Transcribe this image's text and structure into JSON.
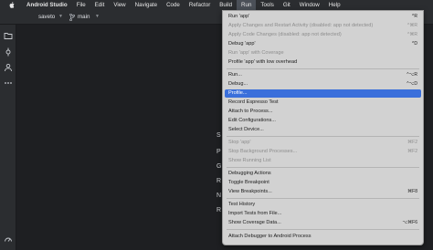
{
  "menubar": {
    "items": [
      {
        "label": "Android Studio"
      },
      {
        "label": "File"
      },
      {
        "label": "Edit"
      },
      {
        "label": "View"
      },
      {
        "label": "Navigate"
      },
      {
        "label": "Code"
      },
      {
        "label": "Refactor"
      },
      {
        "label": "Build"
      },
      {
        "label": "Run"
      },
      {
        "label": "Tools"
      },
      {
        "label": "Git"
      },
      {
        "label": "Window"
      },
      {
        "label": "Help"
      }
    ]
  },
  "toolbar": {
    "project": "saveto",
    "branch": "main"
  },
  "left_toolbar": {
    "icons": [
      "folder-icon",
      "commit-icon",
      "people-icon",
      "more-icon",
      "performance-icon"
    ]
  },
  "editor": {
    "edge_letters": [
      "S",
      "P",
      "G",
      "R",
      "N",
      "R"
    ]
  },
  "run_menu": {
    "items": [
      {
        "label": "Run 'app'",
        "shortcut": "^R",
        "disabled": false
      },
      {
        "label": "Apply Changes and Restart Activity (disabled: app not detected)",
        "shortcut": "^⌘R",
        "disabled": true
      },
      {
        "label": "Apply Code Changes (disabled: app not detected)",
        "shortcut": "^⌘R",
        "disabled": true
      },
      {
        "label": "Debug 'app'",
        "shortcut": "^D",
        "disabled": false
      },
      {
        "label": "Run 'app' with Coverage",
        "shortcut": "",
        "disabled": true
      },
      {
        "label": "Profile 'app' with low overhead",
        "shortcut": "",
        "disabled": false
      },
      {
        "label": "Run...",
        "shortcut": "^⌥R",
        "disabled": false
      },
      {
        "label": "Debug...",
        "shortcut": "^⌥D",
        "disabled": false
      },
      {
        "label": "Profile...",
        "shortcut": "",
        "disabled": false,
        "selected": true
      },
      {
        "label": "Record Espresso Test",
        "shortcut": "",
        "disabled": false
      },
      {
        "label": "Attach to Process...",
        "shortcut": "",
        "disabled": false
      },
      {
        "label": "Edit Configurations...",
        "shortcut": "",
        "disabled": false
      },
      {
        "label": "Select Device...",
        "shortcut": "",
        "disabled": false
      },
      {
        "label": "Stop 'app'",
        "shortcut": "⌘F2",
        "disabled": true
      },
      {
        "label": "Stop Background Processes...",
        "shortcut": "⌘F2",
        "disabled": true
      },
      {
        "label": "Show Running List",
        "shortcut": "",
        "disabled": true
      },
      {
        "label": "Debugging Actions",
        "shortcut": "",
        "disabled": false
      },
      {
        "label": "Toggle Breakpoint",
        "shortcut": "",
        "disabled": false
      },
      {
        "label": "View Breakpoints...",
        "shortcut": "⌘F8",
        "disabled": false
      },
      {
        "label": "Test History",
        "shortcut": "",
        "disabled": false
      },
      {
        "label": "Import Tests from File...",
        "shortcut": "",
        "disabled": false
      },
      {
        "label": "Show Coverage Data...",
        "shortcut": "⌥⌘F6",
        "disabled": false
      },
      {
        "label": "Attach Debugger to Android Process",
        "shortcut": "",
        "disabled": false
      }
    ]
  }
}
